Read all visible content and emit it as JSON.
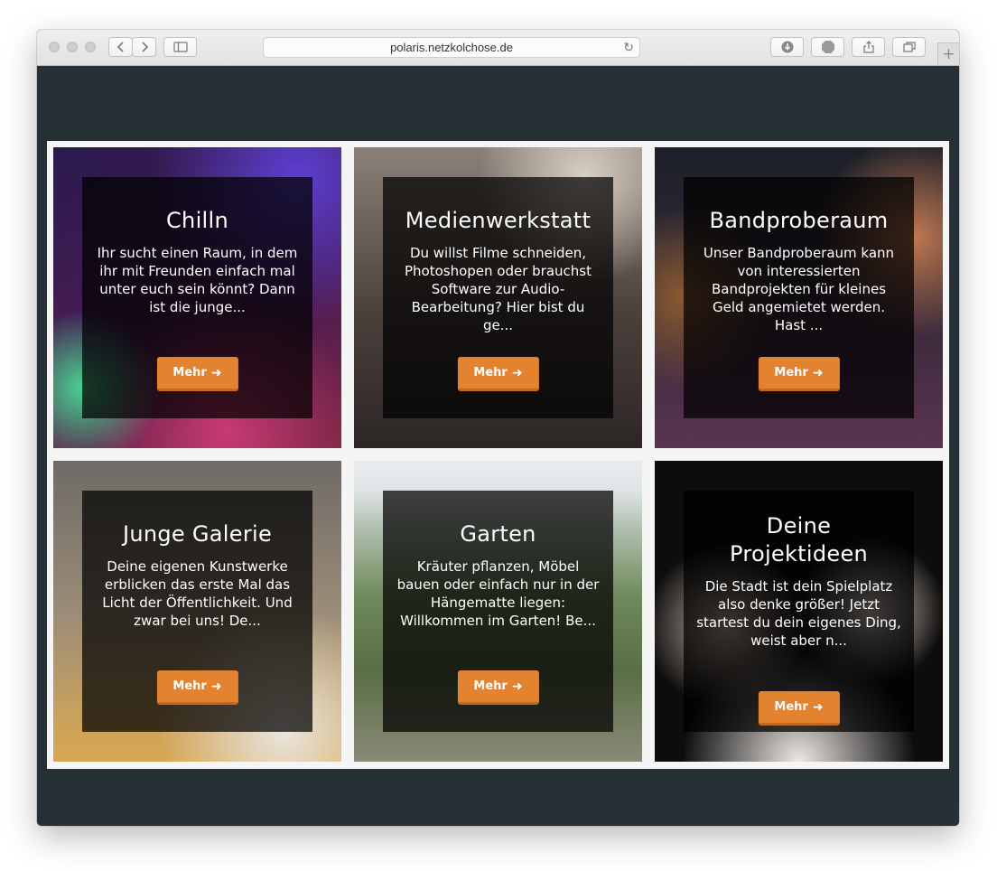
{
  "browser": {
    "url": "polaris.netzkolchose.de"
  },
  "cards": [
    {
      "title": "Chilln",
      "text": "Ihr sucht einen Raum, in dem ihr mit Freunden einfach mal unter euch sein könnt? Dann ist die junge...",
      "button": "Mehr"
    },
    {
      "title": "Medienwerkstatt",
      "text": "Du willst Filme schneiden, Photoshopen oder brauchst Software zur Audio-Bearbeitung? Hier bist du ge...",
      "button": "Mehr"
    },
    {
      "title": "Bandproberaum",
      "text": "Unser Bandproberaum kann von interessierten Bandprojekten für kleines Geld angemietet werden. Hast ...",
      "button": "Mehr"
    },
    {
      "title": "Junge Galerie",
      "text": "Deine eigenen Kunstwerke erblicken das erste Mal das Licht der Öffentlichkeit. Und zwar bei uns! De...",
      "button": "Mehr"
    },
    {
      "title": "Garten",
      "text": "Kräuter pflanzen, Möbel bauen oder einfach nur in der Hängematte liegen: Willkommen im Garten! Be...",
      "button": "Mehr"
    },
    {
      "title": "Deine Projektideen",
      "text": "Die Stadt ist dein Spielplatz also denke größer! Jetzt startest du dein eigenes Ding, weist aber n...",
      "button": "Mehr"
    }
  ],
  "colors": {
    "page_background": "#263135",
    "button": "#e3822f"
  },
  "icons": {
    "button_arrow": "arrow-right-icon"
  }
}
